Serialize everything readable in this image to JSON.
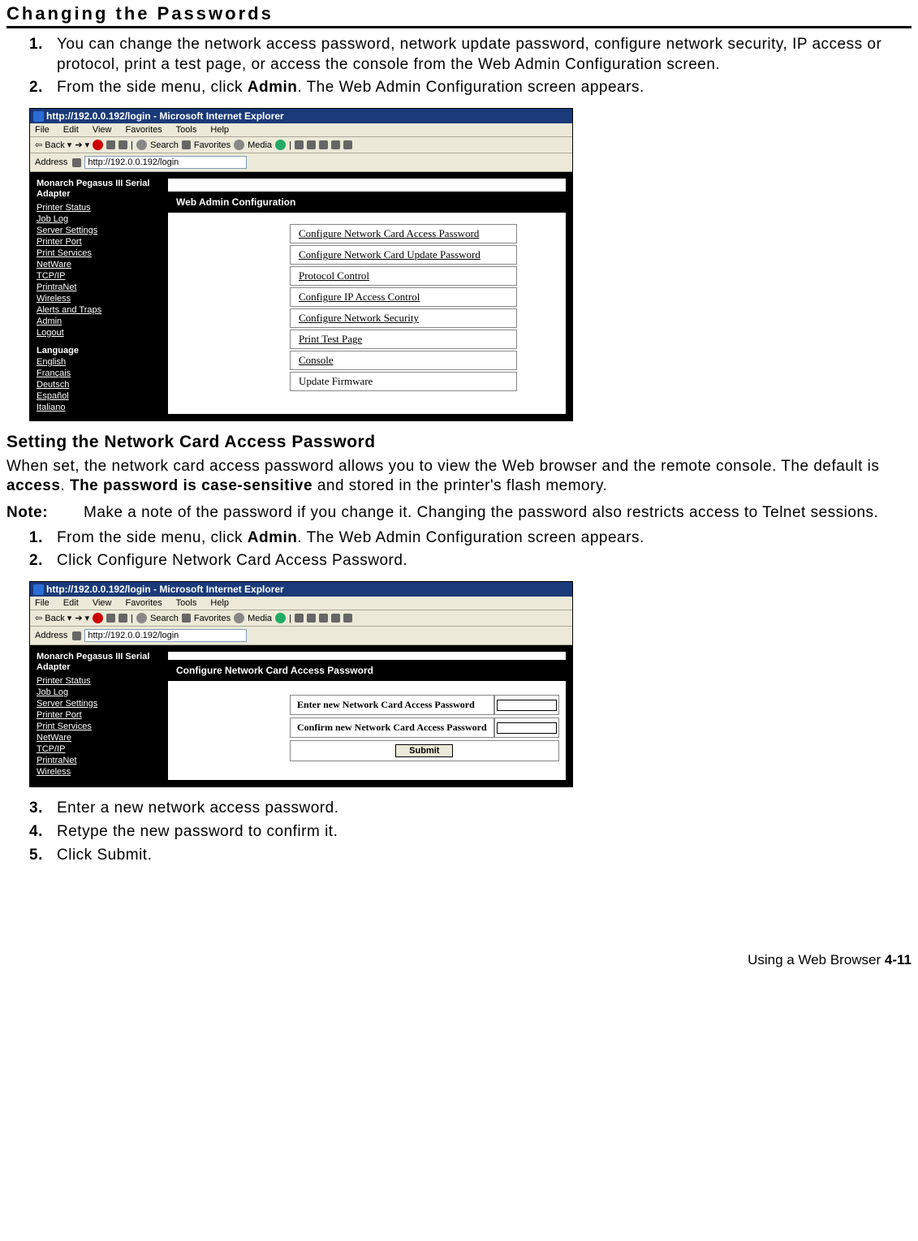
{
  "title": "Changing the Passwords",
  "steps_a": [
    {
      "num": "1.",
      "text_pre": "You can change the network access password, network update password, configure network security, IP access or protocol, print a test page, or access the console from the Web Admin Configuration screen."
    },
    {
      "num": "2.",
      "text_pre": "From the side menu, click ",
      "bold": "Admin",
      "text_post": ". The Web Admin Configuration screen appears."
    }
  ],
  "subheading": "Setting the Network Card Access Password",
  "para_pre": "When set, the network card access password allows you to view the Web browser and the remote console.  The default is ",
  "para_b1": "access",
  "para_mid": ". ",
  "para_b2": "The password is case-sensitive",
  "para_post": " and stored in the printer's flash memory.",
  "note_label": "Note:",
  "note_text": "Make a note of the password if you change it.  Changing the password also restricts access to Telnet sessions.",
  "steps_b": [
    {
      "num": "1.",
      "text_pre": "From the side menu, click ",
      "bold": "Admin",
      "text_post": ".  The Web Admin Configuration screen appears."
    },
    {
      "num": "2.",
      "text_pre": "Click Configure Network Card Access Password."
    }
  ],
  "steps_c": [
    {
      "num": "3.",
      "text_pre": "Enter a new network access password."
    },
    {
      "num": "4.",
      "text_pre": "Retype the new password to confirm it."
    },
    {
      "num": "5.",
      "text_pre": "Click Submit."
    }
  ],
  "footer_text": "Using a Web Browser  ",
  "footer_page": "4-11",
  "ie": {
    "title": "http://192.0.0.192/login - Microsoft Internet Explorer",
    "menu": [
      "File",
      "Edit",
      "View",
      "Favorites",
      "Tools",
      "Help"
    ],
    "tool_back": "Back",
    "tool_search": "Search",
    "tool_fav": "Favorites",
    "tool_media": "Media",
    "addr_label": "Address",
    "addr_url": "http://192.0.0.192/login",
    "side_title": "Monarch Pegasus III Serial Adapter",
    "side_links": [
      "Printer Status",
      "Job Log",
      "Server Settings",
      "Printer Port",
      "Print Services",
      "NetWare",
      "TCP/IP",
      "PrintraNet",
      "Wireless",
      "Alerts and Traps",
      "Admin",
      "Logout"
    ],
    "side_lang": "Language",
    "side_langs": [
      "English",
      "Français",
      "Deutsch",
      "Español",
      "Italiano"
    ],
    "main_h1": "Web Admin Configuration",
    "opts": [
      "Configure Network Card Access Password",
      "Configure Network Card Update Password",
      "Protocol Control",
      "Configure IP Access Control",
      "Configure Network Security",
      "Print Test Page",
      "Console",
      "Update Firmware"
    ],
    "main_h2": "Configure Network Card Access Password",
    "pw_row1": "Enter new Network Card Access Password",
    "pw_row2": "Confirm new Network Card Access Password",
    "submit": "Submit"
  }
}
